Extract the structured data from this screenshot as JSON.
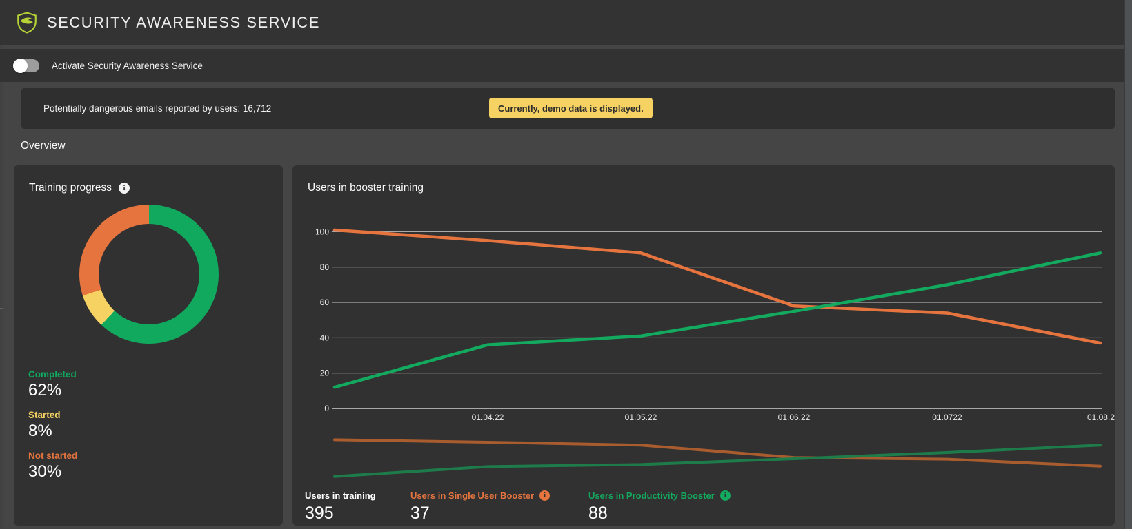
{
  "header": {
    "title": "SECURITY AWARENESS SERVICE",
    "logo": "shield-bird-logo",
    "logo_color": "#b5d335"
  },
  "activation": {
    "label": "Activate Security Awareness Service",
    "state": "off"
  },
  "info_bar": {
    "text": "Potentially dangerous emails reported by users: 16,712",
    "badge": "Currently, demo data is displayed.",
    "badge_bg": "#f6d263"
  },
  "section_title": "Overview",
  "training_card": {
    "title": "Training progress",
    "legend": [
      {
        "label": "Completed",
        "value": "62%",
        "color": "#10a95e"
      },
      {
        "label": "Started",
        "value": "8%",
        "color": "#f6d263"
      },
      {
        "label": "Not started",
        "value": "30%",
        "color": "#e5743f"
      }
    ]
  },
  "booster_card": {
    "title": "Users in booster training",
    "stats": [
      {
        "label": "Users in training",
        "value": "395",
        "color": "#ffffff",
        "info_icon": false
      },
      {
        "label": "Users in Single User Booster",
        "value": "37",
        "color": "#e5743f",
        "info_icon": true
      },
      {
        "label": "Users in Productivity Booster",
        "value": "88",
        "color": "#13a95e",
        "info_icon": true
      }
    ]
  },
  "chart_data": [
    {
      "type": "pie",
      "subtype": "donut",
      "title": "Training progress",
      "labels": [
        "Completed",
        "Started",
        "Not started"
      ],
      "values": [
        62,
        8,
        30
      ],
      "unit": "%",
      "colors": [
        "#10a95e",
        "#f6d263",
        "#e5743f"
      ],
      "start_angle": "top",
      "direction": "clockwise"
    },
    {
      "type": "line",
      "title": "Users in booster training",
      "x_tick_labels": [
        "",
        "01.04.22",
        "01.05.22",
        "01.06.22",
        "01.0722",
        "01.08.2"
      ],
      "yticks": [
        0,
        20,
        40,
        60,
        80,
        100
      ],
      "ylim": [
        0,
        105
      ],
      "grid": true,
      "series": [
        {
          "name": "Users in Single User Booster",
          "color": "#e5743f",
          "values": [
            101,
            95,
            88,
            58,
            54,
            37
          ]
        },
        {
          "name": "Users in Productivity Booster",
          "color": "#13a95e",
          "values": [
            12,
            36,
            41,
            55,
            70,
            88
          ]
        }
      ],
      "navigator": {
        "present": true,
        "colors": [
          "#a95d2f",
          "#1e7c4b"
        ]
      }
    }
  ]
}
